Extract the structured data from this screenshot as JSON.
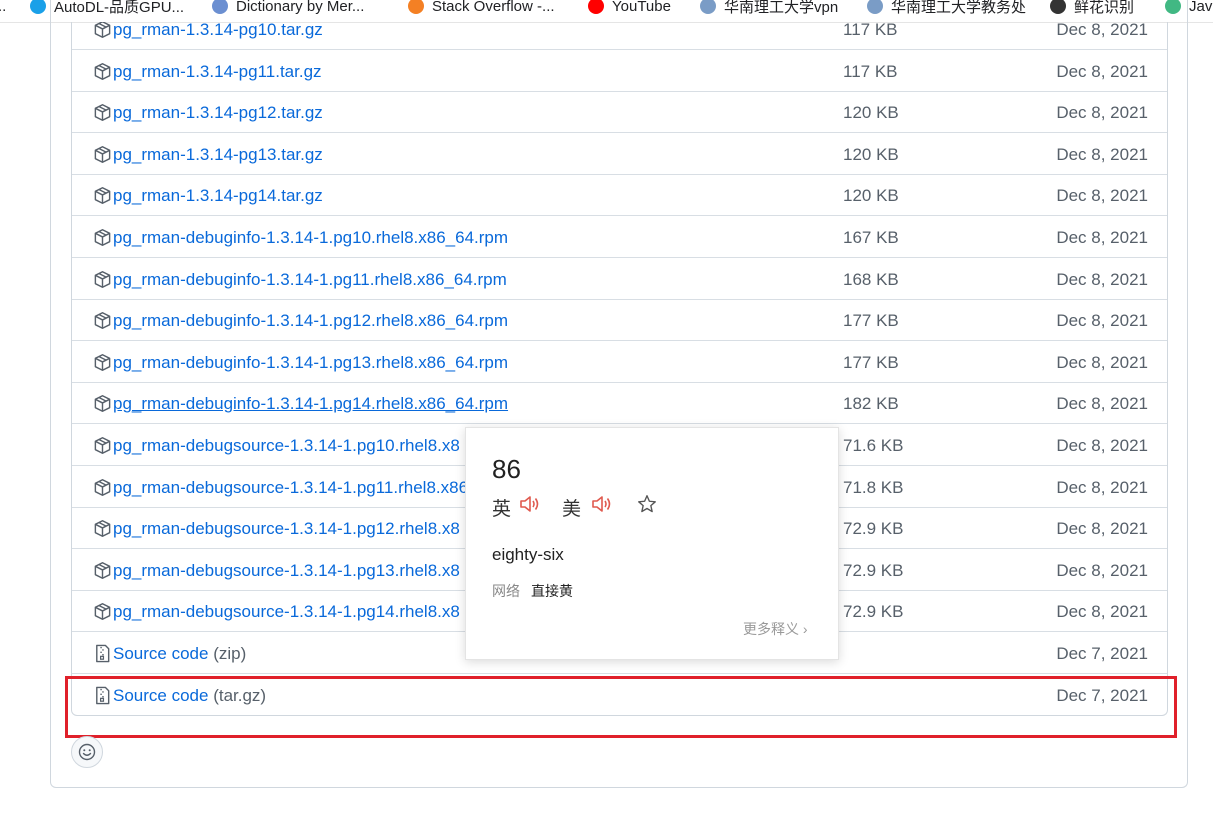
{
  "bookmarks": [
    {
      "label": "AutoDL-品质GPU...",
      "icon": "autodl-icon",
      "color": "#1aa0e8"
    },
    {
      "label": "Dictionary by Mer...",
      "icon": "merriam-webster-icon",
      "color": "#6b8fd1"
    },
    {
      "label": "Stack Overflow -...",
      "icon": "stack-overflow-icon",
      "color": "#f48024"
    },
    {
      "label": "YouTube",
      "icon": "youtube-icon",
      "color": "#ff0000"
    },
    {
      "label": "华南理工大学vpn",
      "icon": "scut-vpn-icon",
      "color": "#7a9cc6"
    },
    {
      "label": "华南理工大学教务处",
      "icon": "scut-jwc-icon",
      "color": "#7a9cc6"
    },
    {
      "label": "鲜花识别",
      "icon": "flower-icon",
      "color": "#333333"
    },
    {
      "label": "Java",
      "icon": "vue-icon",
      "color": "#41b883"
    }
  ],
  "assets": [
    {
      "name": "pg_rman-1.3.14-pg10.tar.gz",
      "size": "117 KB",
      "date": "Dec 8, 2021"
    },
    {
      "name": "pg_rman-1.3.14-pg11.tar.gz",
      "size": "117 KB",
      "date": "Dec 8, 2021"
    },
    {
      "name": "pg_rman-1.3.14-pg12.tar.gz",
      "size": "120 KB",
      "date": "Dec 8, 2021"
    },
    {
      "name": "pg_rman-1.3.14-pg13.tar.gz",
      "size": "120 KB",
      "date": "Dec 8, 2021"
    },
    {
      "name": "pg_rman-1.3.14-pg14.tar.gz",
      "size": "120 KB",
      "date": "Dec 8, 2021"
    },
    {
      "name": "pg_rman-debuginfo-1.3.14-1.pg10.rhel8.x86_64.rpm",
      "size": "167 KB",
      "date": "Dec 8, 2021"
    },
    {
      "name": "pg_rman-debuginfo-1.3.14-1.pg11.rhel8.x86_64.rpm",
      "size": "168 KB",
      "date": "Dec 8, 2021"
    },
    {
      "name": "pg_rman-debuginfo-1.3.14-1.pg12.rhel8.x86_64.rpm",
      "size": "177 KB",
      "date": "Dec 8, 2021"
    },
    {
      "name": "pg_rman-debuginfo-1.3.14-1.pg13.rhel8.x86_64.rpm",
      "size": "177 KB",
      "date": "Dec 8, 2021"
    },
    {
      "name": "pg_rman-debuginfo-1.3.14-1.pg14.rhel8.x86_64.rpm",
      "size": "182 KB",
      "date": "Dec 8, 2021"
    },
    {
      "name": "pg_rman-debugsource-1.3.14-1.pg10.rhel8.x8",
      "size": "71.6 KB",
      "date": "Dec 8, 2021"
    },
    {
      "name": "pg_rman-debugsource-1.3.14-1.pg11.rhel8.x86",
      "size": "71.8 KB",
      "date": "Dec 8, 2021"
    },
    {
      "name": "pg_rman-debugsource-1.3.14-1.pg12.rhel8.x8",
      "size": "72.9 KB",
      "date": "Dec 8, 2021"
    },
    {
      "name": "pg_rman-debugsource-1.3.14-1.pg13.rhel8.x8",
      "size": "72.9 KB",
      "date": "Dec 8, 2021"
    },
    {
      "name": "pg_rman-debugsource-1.3.14-1.pg14.rhel8.x8",
      "size": "72.9 KB",
      "date": "Dec 8, 2021"
    },
    {
      "name": "Source code",
      "suffix": "(zip)",
      "size": "",
      "date": "Dec 7, 2021",
      "source": true
    },
    {
      "name": "Source code",
      "suffix": "(tar.gz)",
      "size": "",
      "date": "Dec 7, 2021",
      "source": true
    }
  ],
  "hovered_index": 9,
  "highlight_color": "#e0202a",
  "link_color": "#0969da",
  "dictionary_popup": {
    "word": "86",
    "uk_label": "英",
    "us_label": "美",
    "definition": "eighty-six",
    "network_label": "网络",
    "network_value": "直接黄",
    "more_label": "更多释义",
    "speaker_color": "#e05a4f"
  }
}
